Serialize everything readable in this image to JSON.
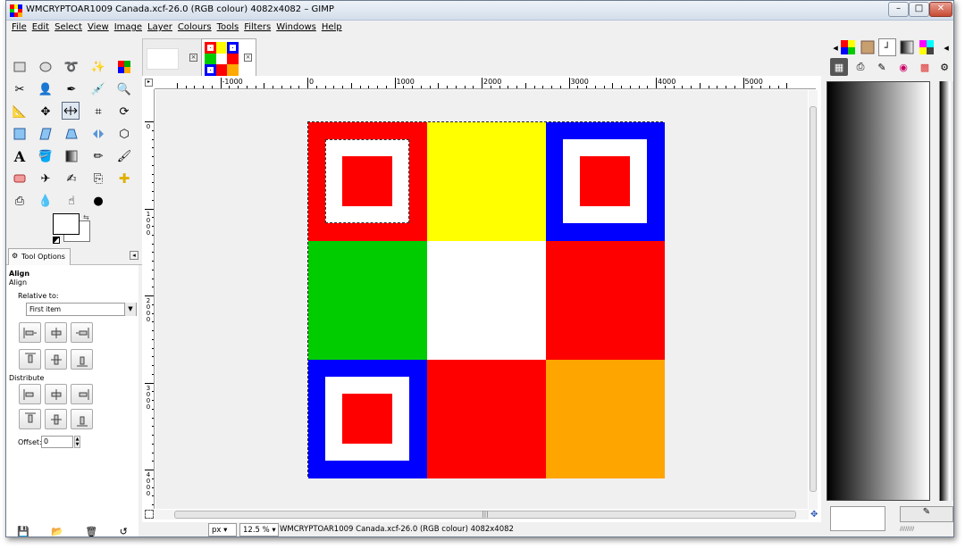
{
  "window": {
    "title": "WMCRYPTOAR1009 Canada.xcf-26.0 (RGB colour) 4082x4082 – GIMP",
    "controls": {
      "minimize": "–",
      "maximize": "□",
      "close": "✕"
    }
  },
  "menubar": [
    "File",
    "Edit",
    "Select",
    "View",
    "Image",
    "Layer",
    "Colours",
    "Tools",
    "Filters",
    "Windows",
    "Help"
  ],
  "tool_options": {
    "tab_label": "Tool Options",
    "heading": "Align",
    "subheading": "Align",
    "relative_to_label": "Relative to:",
    "relative_to_value": "First item",
    "distribute_label": "Distribute",
    "offset_label": "Offset:",
    "offset_value": "0"
  },
  "rulers": {
    "h_labels": [
      "-1000",
      "0",
      "1000",
      "2000",
      "3000",
      "4000",
      "5000"
    ],
    "v_labels": [
      "0",
      "1000",
      "2000",
      "3000",
      "4000"
    ]
  },
  "image_tabs": {
    "close_symbol": "×"
  },
  "image_grid": {
    "colors": [
      "#ff0000",
      "#ffff00",
      "#0000ff",
      "#00cc00",
      "#ffffff",
      "#ff0000",
      "#0000ff",
      "#ff0000",
      "#ffa500"
    ],
    "framed_cells": [
      0,
      2,
      6
    ]
  },
  "statusbar": {
    "unit": "px",
    "zoom": "12.5 %",
    "text": "WMCRYPTOAR1009 Canada.xcf-26.0 (RGB colour) 4082x4082"
  },
  "scrollbar": {
    "grip": "|||"
  },
  "right_dock": {
    "swatch_dots": "////////"
  }
}
